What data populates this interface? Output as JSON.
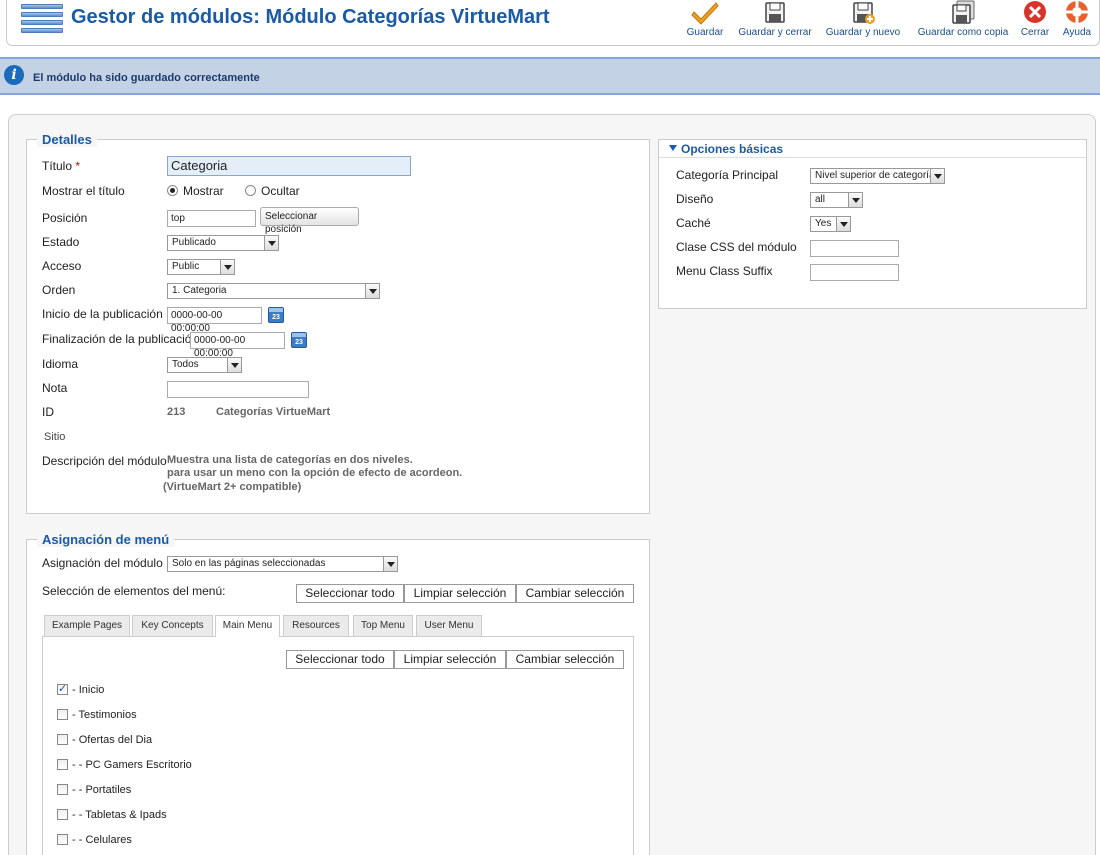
{
  "toolbar": {
    "title": "Gestor de módulos: Módulo Categorías VirtueMart",
    "buttons": {
      "save": "Guardar",
      "save_close": "Guardar y cerrar",
      "save_new": "Guardar y nuevo",
      "save_copy": "Guardar como copia",
      "close": "Cerrar",
      "help": "Ayuda"
    }
  },
  "message": {
    "text": "El módulo ha sido guardado correctamente"
  },
  "details": {
    "legend": "Detalles",
    "title_label": "Título",
    "required_mark": "*",
    "title_value": "Categoria",
    "show_title_label": "Mostrar el título",
    "show_option": "Mostrar",
    "hide_option": "Ocultar",
    "position_label": "Posición",
    "position_value": "top",
    "select_position_button": "Seleccionar posición",
    "state_label": "Estado",
    "state_value": "Publicado",
    "access_label": "Acceso",
    "access_value": "Public",
    "order_label": "Orden",
    "order_value": "1. Categoria",
    "publish_up_label": "Inicio de la publicación",
    "publish_up_value": "0000-00-00 00:00:00",
    "publish_down_label": "Finalización de la publicación",
    "publish_down_value": "0000-00-00 00:00:00",
    "calendar_day": "23",
    "language_label": "Idioma",
    "language_value": "Todos",
    "note_label": "Nota",
    "note_value": "",
    "id_label": "ID",
    "id_value": "213",
    "module_name": "Categorías VirtueMart",
    "site_label": "Sitio",
    "description_label": "Descripción del módulo",
    "description_line1": "Muestra una lista de categorías en dos niveles.",
    "description_line2": "para usar un meno con la opción de efecto de acordeon.",
    "description_line3": "(VirtueMart 2+ compatible)"
  },
  "basic_options": {
    "header": "Opciones básicas",
    "parent_category_label": "Categoría Principal",
    "parent_category_value": "Nivel superior de categoría",
    "layout_label": "Diseño",
    "layout_value": "all",
    "cache_label": "Caché",
    "cache_value": "Yes",
    "css_class_label": "Clase CSS del módulo",
    "css_class_value": "",
    "menu_suffix_label": "Menu Class Suffix",
    "menu_suffix_value": ""
  },
  "menu_assignment": {
    "legend": "Asignación de menú",
    "assignment_label": "Asignación del módulo",
    "assignment_value": "Solo en las páginas seleccionadas",
    "selection_label": "Selección de elementos del menú:",
    "select_all": "Seleccionar todo",
    "clear_selection": "Limpiar selección",
    "toggle_selection": "Cambiar selección",
    "tabs": [
      "Example Pages",
      "Key Concepts",
      "Main Menu",
      "Resources",
      "Top Menu",
      "User Menu"
    ],
    "active_tab": "Main Menu",
    "items": [
      {
        "label": "- Inicio",
        "checked": true
      },
      {
        "label": "- Testimonios",
        "checked": false
      },
      {
        "label": "- Ofertas del Dia",
        "checked": false
      },
      {
        "label": "- - PC Gamers Escritorio",
        "checked": false
      },
      {
        "label": "- - Portatiles",
        "checked": false
      },
      {
        "label": "- - Tabletas & Ipads",
        "checked": false
      },
      {
        "label": "- - Celulares",
        "checked": false
      }
    ]
  },
  "colors": {
    "title_blue": "#1a5aa6",
    "message_bg": "#c3d2e5",
    "save_orange": "#f0a020",
    "close_red": "#d9342b"
  }
}
